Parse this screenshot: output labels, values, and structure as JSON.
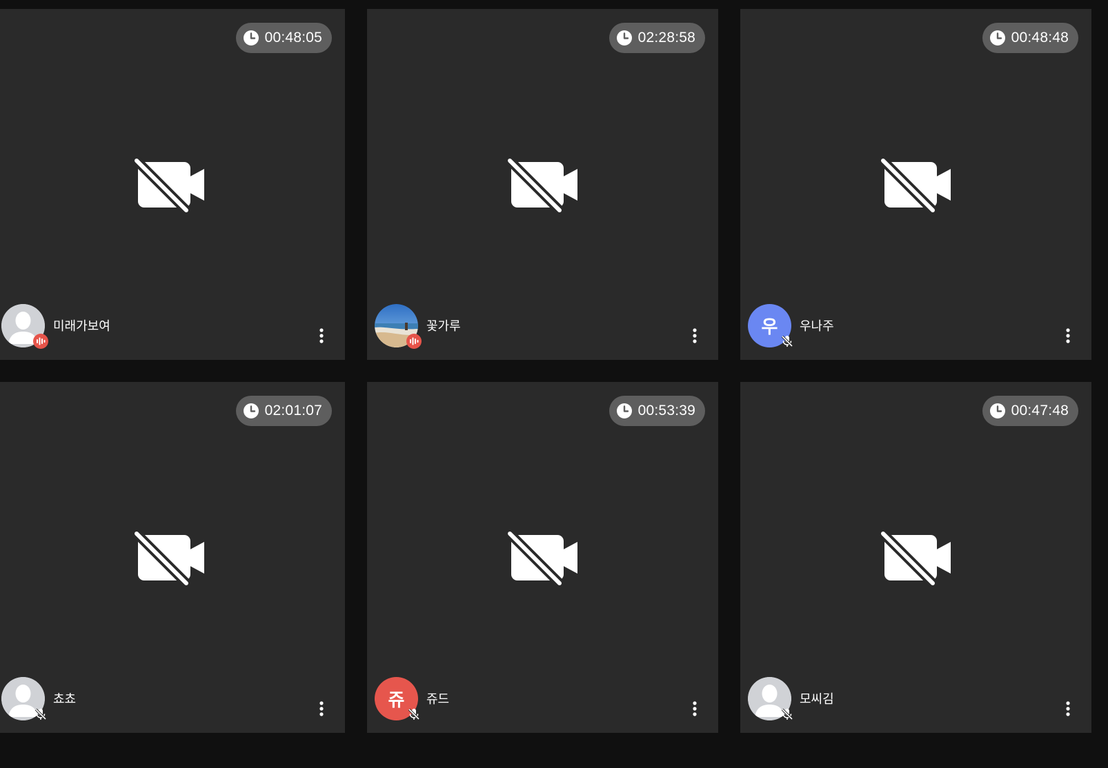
{
  "colors": {
    "page_bg": "#101010",
    "tile_bg": "#2a2a2a",
    "timer_bg": "#5e5e5e",
    "speaking_badge": "#e6544a",
    "avatar_blue": "#6a87f2",
    "avatar_red": "#e6564d"
  },
  "participants": [
    {
      "name": "미래가보여",
      "timer": "00:48:05",
      "avatar": "default-user-icon",
      "audio": "speaking"
    },
    {
      "name": "꽃가루",
      "timer": "02:28:58",
      "avatar": "beach-photo",
      "audio": "speaking"
    },
    {
      "name": "우나주",
      "timer": "00:48:48",
      "avatar_initial": "우",
      "avatar_color": "#6a87f2",
      "audio": "muted"
    },
    {
      "name": "쵸쵸",
      "timer": "02:01:07",
      "avatar": "default-user-icon",
      "audio": "muted"
    },
    {
      "name": "쥬드",
      "timer": "00:53:39",
      "avatar_initial": "쥬",
      "avatar_color": "#e6564d",
      "audio": "muted"
    },
    {
      "name": "모씨김",
      "timer": "00:47:48",
      "avatar": "default-user-icon",
      "audio": "muted"
    }
  ]
}
